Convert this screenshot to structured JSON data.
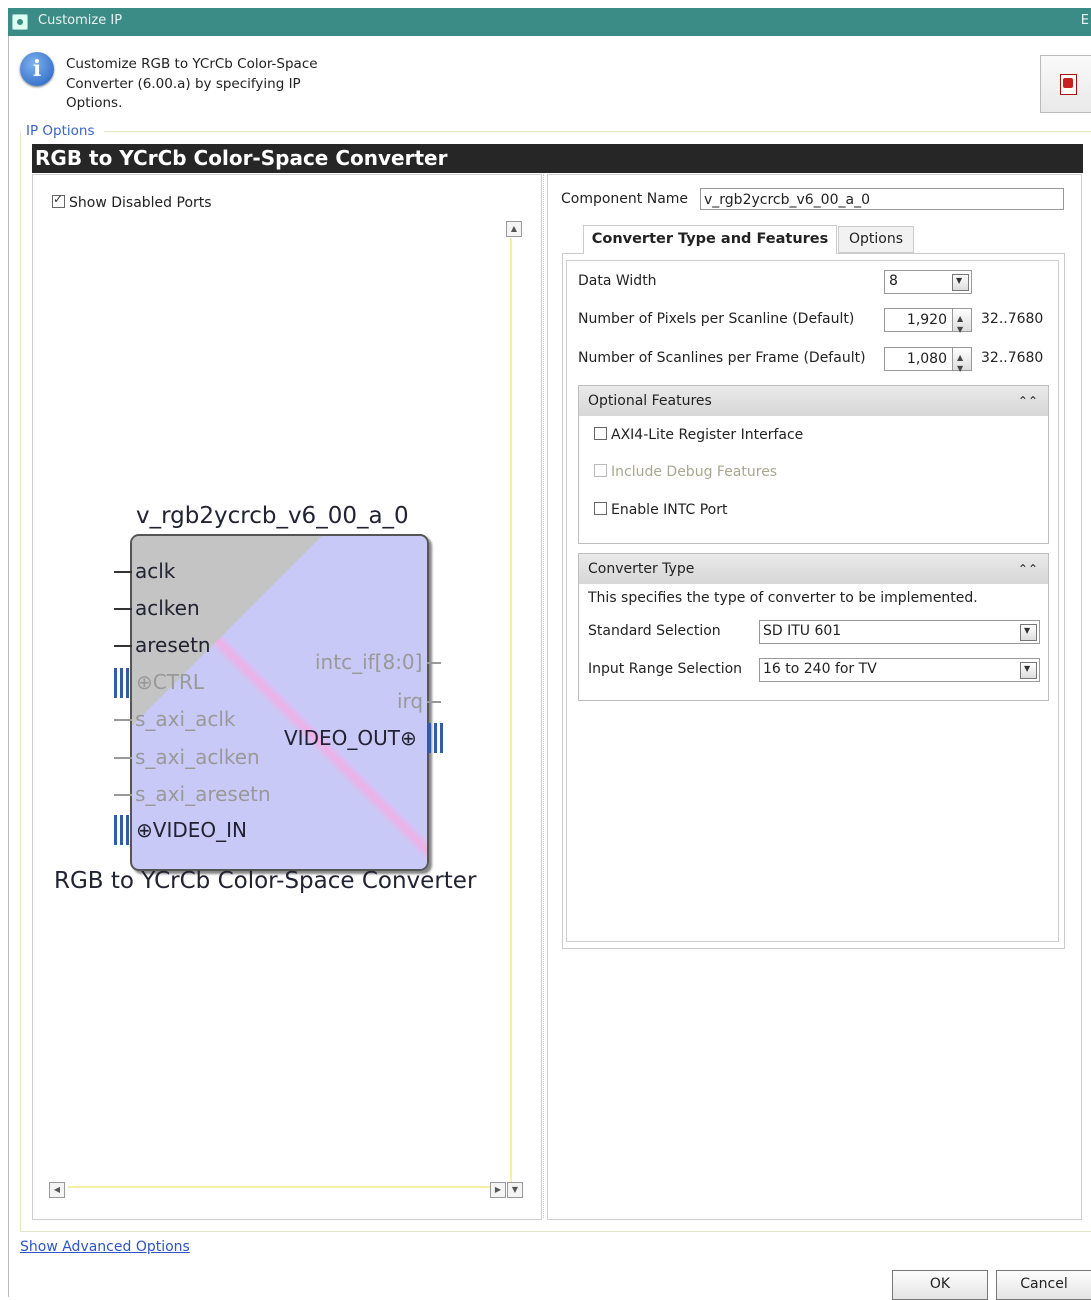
{
  "window": {
    "title": "Customize IP",
    "title_end": "E"
  },
  "header": {
    "description": "Customize RGB to YCrCb Color-Space Converter (6.00.a) by specifying IP Options.",
    "ip_options_label": "IP Options",
    "banner": "RGB to YCrCb Color-Space Converter"
  },
  "left": {
    "show_disabled_ports": {
      "label": "Show Disabled Ports",
      "checked": true
    },
    "symbol": {
      "instance_name": "v_rgb2ycrcb_v6_00_a_0",
      "caption": "RGB to YCrCb Color-Space Converter",
      "left_pins": [
        "aclk",
        "aclken",
        "aresetn",
        "CTRL",
        "s_axi_aclk",
        "s_axi_aclken",
        "s_axi_aresetn",
        "VIDEO_IN"
      ],
      "right_pins": [
        "intc_if[8:0]",
        "irq",
        "VIDEO_OUT"
      ],
      "bus_plus": "⊕"
    }
  },
  "right": {
    "component_name_label": "Component Name",
    "component_name_value": "v_rgb2ycrcb_v6_00_a_0",
    "tabs": [
      "Converter Type and Features",
      "Options"
    ],
    "fields": {
      "data_width": {
        "label": "Data Width",
        "value": "8"
      },
      "pixels": {
        "label": "Number of Pixels per Scanline (Default)",
        "value": "1,920",
        "range": "32..7680"
      },
      "scanlines": {
        "label": "Number of Scanlines per Frame (Default)",
        "value": "1,080",
        "range": "32..7680"
      }
    },
    "optional_features": {
      "title": "Optional Features",
      "items": [
        {
          "label": "AXI4-Lite Register Interface",
          "checked": false,
          "enabled": true
        },
        {
          "label": "Include Debug Features",
          "checked": false,
          "enabled": false
        },
        {
          "label": "Enable INTC Port",
          "checked": false,
          "enabled": true
        }
      ]
    },
    "converter_type": {
      "title": "Converter Type",
      "description": "This specifies the type of converter to be implemented.",
      "standard_label": "Standard Selection",
      "standard_value": "SD ITU 601",
      "input_range_label": "Input Range Selection",
      "input_range_value": "16 to 240 for TV"
    }
  },
  "footer": {
    "advanced_link": "Show Advanced Options",
    "ok": "OK",
    "cancel": "Cancel"
  }
}
